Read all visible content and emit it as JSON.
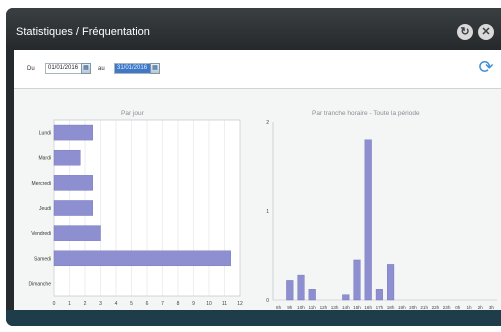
{
  "window": {
    "title": "Statistiques / Fréquentation",
    "refresh_icon": "refresh-icon",
    "close_icon": "close-icon",
    "restore_icon": "restore-icon"
  },
  "filters": {
    "from_label": "Du",
    "from_value": "01/01/2016",
    "to_label": "au",
    "to_value": "31/01/2016",
    "calendar_icon": "calendar-icon"
  },
  "chart_data": [
    {
      "type": "bar",
      "orientation": "horizontal",
      "title": "Par jour",
      "categories": [
        "Lundi",
        "Mardi",
        "Mercredi",
        "Jeudi",
        "Vendredi",
        "Samedi",
        "Dimanche"
      ],
      "values": [
        2.5,
        1.7,
        2.5,
        2.5,
        3,
        11.4,
        0
      ],
      "xlim": [
        0,
        12
      ],
      "xticks": [
        "0",
        "1",
        "2",
        "3",
        "4",
        "5",
        "6",
        "7",
        "8",
        "9",
        "10",
        "11",
        "12"
      ],
      "grid": true,
      "color": "#8d8fd0"
    },
    {
      "type": "bar",
      "title": "Par tranche horaire - Toute la période",
      "categories": [
        "8h",
        "9h",
        "10h",
        "11h",
        "12h",
        "13h",
        "14h",
        "15h",
        "16h",
        "17h",
        "18h",
        "19h",
        "20h",
        "21h",
        "22h",
        "23h",
        "0h",
        "1h",
        "2h",
        "3h"
      ],
      "values": [
        0,
        0.22,
        0.28,
        0.12,
        0,
        0,
        0.06,
        0.45,
        1.8,
        0.12,
        0.4,
        0,
        0,
        0,
        0,
        0,
        0,
        0,
        0,
        0
      ],
      "ylim": [
        0,
        2
      ],
      "yticks": [
        "0",
        "1",
        "2"
      ],
      "grid": false,
      "color": "#8d8fd0"
    }
  ]
}
